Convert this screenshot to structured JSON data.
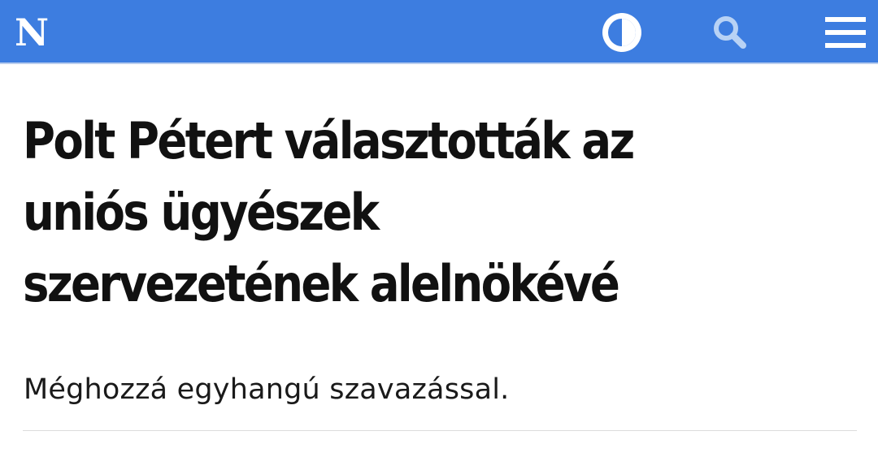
{
  "header": {
    "logo": "N",
    "background_color": "#3d7de0",
    "icons": {
      "contrast": "contrast-icon",
      "search": "search-icon",
      "menu": "hamburger-menu-icon"
    }
  },
  "article": {
    "title_line_1": "Polt Pétert választották az",
    "title_line_2": "uniós ügyészek",
    "title_line_3": "szervezetének alelnökévé",
    "lead": "Méghozzá egyhangú szavazással."
  }
}
